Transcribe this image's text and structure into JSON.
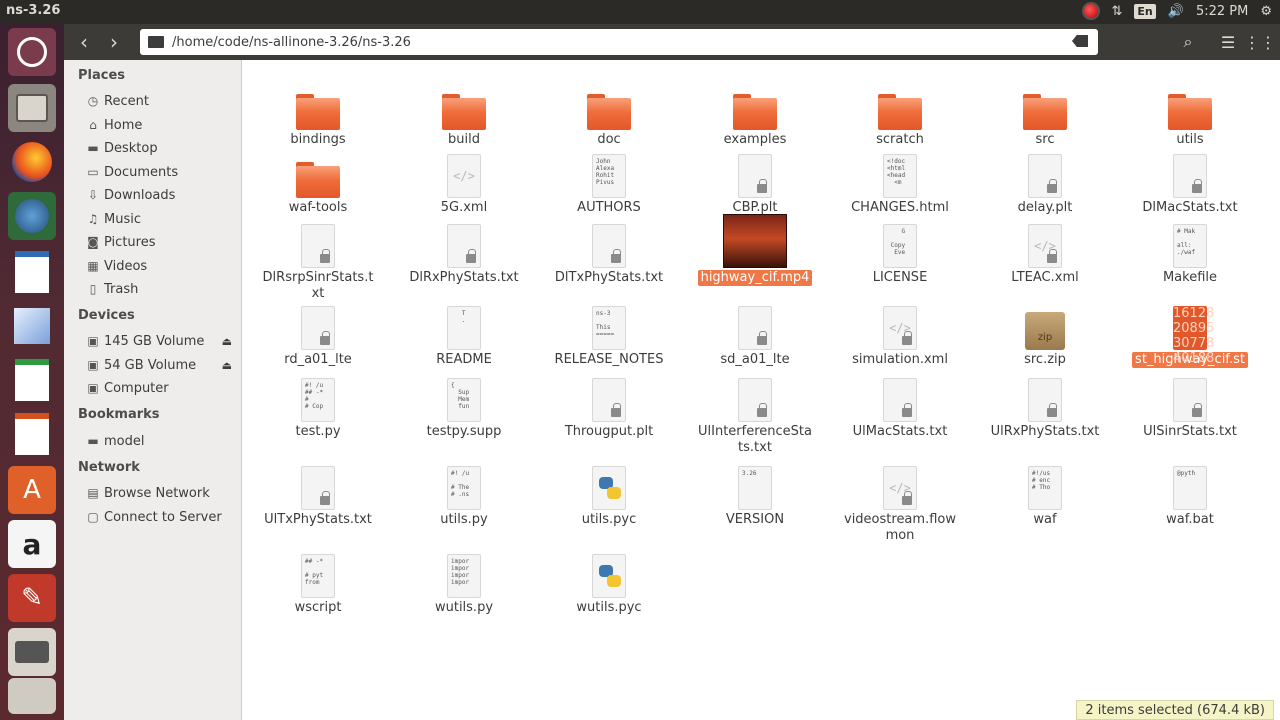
{
  "window": {
    "title": "ns-3.26"
  },
  "topbar": {
    "lang": "En",
    "clock": "5:22 PM"
  },
  "header": {
    "path": "/home/code/ns-allinone-3.26/ns-3.26"
  },
  "sidebar": {
    "places_heading": "Places",
    "places": [
      {
        "label": "Recent",
        "icon": "clock-icon"
      },
      {
        "label": "Home",
        "icon": "home-icon"
      },
      {
        "label": "Desktop",
        "icon": "desktop-folder-icon"
      },
      {
        "label": "Documents",
        "icon": "documents-icon"
      },
      {
        "label": "Downloads",
        "icon": "download-icon"
      },
      {
        "label": "Music",
        "icon": "music-icon"
      },
      {
        "label": "Pictures",
        "icon": "camera-icon"
      },
      {
        "label": "Videos",
        "icon": "film-icon"
      },
      {
        "label": "Trash",
        "icon": "trash-icon"
      }
    ],
    "devices_heading": "Devices",
    "devices": [
      {
        "label": "145 GB Volume",
        "icon": "drive-icon"
      },
      {
        "label": "54 GB Volume",
        "icon": "drive-icon"
      },
      {
        "label": "Computer",
        "icon": "drive-icon"
      }
    ],
    "bookmarks_heading": "Bookmarks",
    "bookmarks": [
      {
        "label": "model",
        "icon": "folder-icon"
      }
    ],
    "network_heading": "Network",
    "network": [
      {
        "label": "Browse Network",
        "icon": "network-icon"
      },
      {
        "label": "Connect to Server",
        "icon": "server-icon"
      }
    ]
  },
  "files": [
    {
      "name": "bindings",
      "kind": "folder"
    },
    {
      "name": "build",
      "kind": "folder"
    },
    {
      "name": "doc",
      "kind": "folder"
    },
    {
      "name": "examples",
      "kind": "folder"
    },
    {
      "name": "scratch",
      "kind": "folder"
    },
    {
      "name": "src",
      "kind": "folder"
    },
    {
      "name": "utils",
      "kind": "folder"
    },
    {
      "name": "waf-tools",
      "kind": "folder"
    },
    {
      "name": "5G.xml",
      "kind": "xml"
    },
    {
      "name": "AUTHORS",
      "kind": "text",
      "preview": "John\nAlexa\nRohit\nPivus"
    },
    {
      "name": "CBP.plt",
      "kind": "locked"
    },
    {
      "name": "CHANGES.html",
      "kind": "text",
      "preview": "<!doc\n<html\n<head\n  <m"
    },
    {
      "name": "delay.plt",
      "kind": "locked"
    },
    {
      "name": "DlMacStats.txt",
      "kind": "locked"
    },
    {
      "name": "DlRsrpSinrStats.txt",
      "kind": "locked"
    },
    {
      "name": "DlRxPhyStats.txt",
      "kind": "locked"
    },
    {
      "name": "DlTxPhyStats.txt",
      "kind": "locked"
    },
    {
      "name": "highway_cif.mp4",
      "kind": "video",
      "selected": true
    },
    {
      "name": "LICENSE",
      "kind": "text",
      "preview": "    G\n\n Copy\n  Eve"
    },
    {
      "name": "LTEAC.xml",
      "kind": "xml-locked"
    },
    {
      "name": "Makefile",
      "kind": "text",
      "preview": "# Mak\n\nall:\n./waf"
    },
    {
      "name": "rd_a01_lte",
      "kind": "locked"
    },
    {
      "name": "README",
      "kind": "text",
      "preview": "   T\n   ."
    },
    {
      "name": "RELEASE_NOTES",
      "kind": "text",
      "preview": "ns-3\n\nThis\n====="
    },
    {
      "name": "sd_a01_lte",
      "kind": "locked"
    },
    {
      "name": "simulation.xml",
      "kind": "xml-locked"
    },
    {
      "name": "src.zip",
      "kind": "zip",
      "zip_text": "zip"
    },
    {
      "name": "st_highway_cif.st",
      "kind": "st",
      "selected": true,
      "preview": "16128\n20895\n30778\n40188"
    },
    {
      "name": "test.py",
      "kind": "text",
      "preview": "#! /u\n## -*\n#\n# Cop"
    },
    {
      "name": "testpy.supp",
      "kind": "text",
      "preview": "{\n  Sup\n  Mem\n  fun"
    },
    {
      "name": "Througput.plt",
      "kind": "locked"
    },
    {
      "name": "UlInterferenceStats.txt",
      "kind": "locked"
    },
    {
      "name": "UlMacStats.txt",
      "kind": "locked"
    },
    {
      "name": "UlRxPhyStats.txt",
      "kind": "locked"
    },
    {
      "name": "UlSinrStats.txt",
      "kind": "locked"
    },
    {
      "name": "UlTxPhyStats.txt",
      "kind": "locked"
    },
    {
      "name": "utils.py",
      "kind": "text",
      "preview": "#! /u\n\n# The\n# .ns"
    },
    {
      "name": "utils.pyc",
      "kind": "python"
    },
    {
      "name": "VERSION",
      "kind": "text",
      "preview": "3.26"
    },
    {
      "name": "videostream.flowmon",
      "kind": "xml-locked"
    },
    {
      "name": "waf",
      "kind": "text",
      "preview": "#!/us\n# enc\n# Tho"
    },
    {
      "name": "waf.bat",
      "kind": "text",
      "preview": "@pyth"
    },
    {
      "name": "wscript",
      "kind": "text",
      "preview": "## -*\n\n# pyt\nfrom"
    },
    {
      "name": "wutils.py",
      "kind": "text",
      "preview": "impor\nimpor\nimpor\nimpor"
    },
    {
      "name": "wutils.pyc",
      "kind": "python"
    }
  ],
  "status": {
    "text": "2 items selected  (674.4 kB)"
  },
  "colors": {
    "accent": "#f07746",
    "folder": "#ef6d3a",
    "topbar": "#2b2a27",
    "launcher": "#512a33"
  }
}
